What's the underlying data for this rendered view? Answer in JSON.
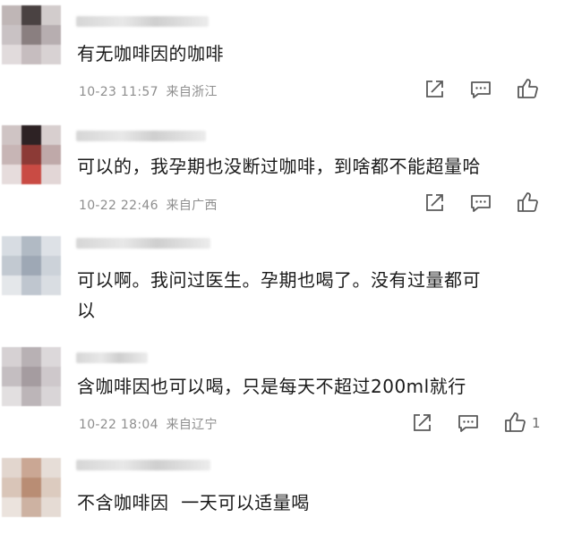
{
  "comments": [
    {
      "text": "有无咖啡因的咖啡",
      "time": "10-23 11:57",
      "location": "来自浙江",
      "likes": ""
    },
    {
      "text": "可以的，我孕期也没断过咖啡，到啥都不能超量哈",
      "time": "10-22 22:46",
      "location": "来自广西",
      "likes": ""
    },
    {
      "text": "可以啊。我问过医生。孕期也喝了。没有过量都可\n以",
      "time": "",
      "location": "",
      "likes": ""
    },
    {
      "text": "含咖啡因也可以喝，只是每天不超过200ml就行",
      "time": "10-22 18:04",
      "location": "来自辽宁",
      "likes": "1"
    },
    {
      "text": "不含咖啡因  一天可以适量喝",
      "time": "",
      "location": "",
      "likes": ""
    }
  ],
  "icons": {
    "share": "share-icon",
    "reply": "comment-icon",
    "like": "thumbs-up-icon"
  },
  "colors": {
    "text": "#1a1a1a",
    "meta": "#8e8e8e",
    "icon": "#5a5a5a"
  }
}
